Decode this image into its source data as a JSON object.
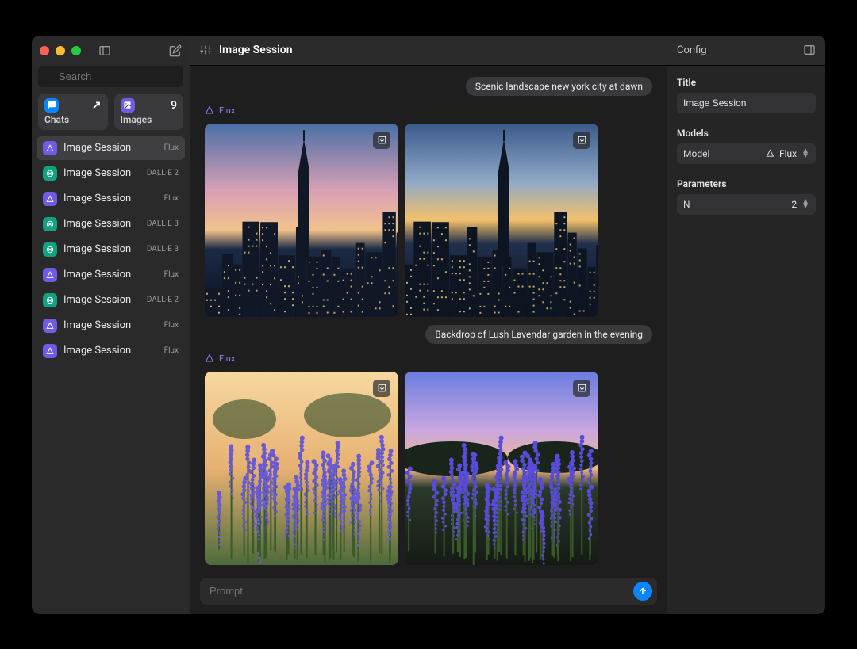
{
  "sidebar": {
    "search_placeholder": "Search",
    "tabs": {
      "chats": {
        "label": "Chats",
        "right_glyph": "↗"
      },
      "images": {
        "label": "Images",
        "count": "9"
      }
    },
    "sessions": [
      {
        "label": "Image Session",
        "model": "Flux",
        "icon": "flux",
        "selected": true
      },
      {
        "label": "Image Session",
        "model": "DALL·E 2",
        "icon": "dalle",
        "selected": false
      },
      {
        "label": "Image Session",
        "model": "Flux",
        "icon": "flux",
        "selected": false
      },
      {
        "label": "Image Session",
        "model": "DALL·E 3",
        "icon": "dalle",
        "selected": false
      },
      {
        "label": "Image Session",
        "model": "DALL·E 3",
        "icon": "dalle",
        "selected": false
      },
      {
        "label": "Image Session",
        "model": "Flux",
        "icon": "flux",
        "selected": false
      },
      {
        "label": "Image Session",
        "model": "DALL·E 2",
        "icon": "dalle",
        "selected": false
      },
      {
        "label": "Image Session",
        "model": "Flux",
        "icon": "flux",
        "selected": false
      },
      {
        "label": "Image Session",
        "model": "Flux",
        "icon": "flux",
        "selected": false
      }
    ]
  },
  "main": {
    "title": "Image Session",
    "blocks": [
      {
        "prompt": "Scenic landscape new york city at dawn",
        "model": "Flux"
      },
      {
        "prompt": "Backdrop of Lush Lavendar garden in the evening",
        "model": "Flux"
      }
    ],
    "prompt_placeholder": "Prompt"
  },
  "config": {
    "header": "Config",
    "title_section": "Title",
    "title_value": "Image Session",
    "models_section": "Models",
    "model_label": "Model",
    "model_value": "Flux",
    "params_section": "Parameters",
    "n_label": "N",
    "n_value": "2"
  }
}
